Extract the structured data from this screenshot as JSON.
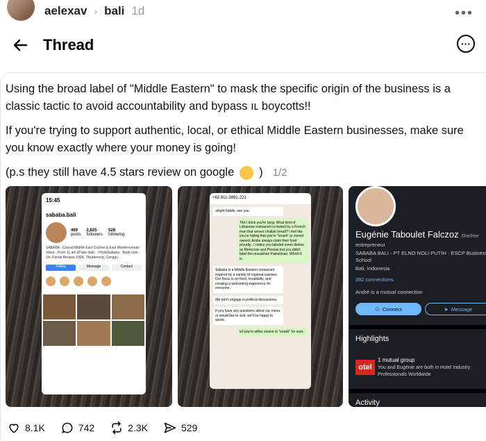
{
  "topbar": {
    "username": "aelexav",
    "location": "bali",
    "time": "1d"
  },
  "header": {
    "title": "Thread"
  },
  "post": {
    "paragraph1": "Using the broad label of \"Middle Eastern\" to mask the specific origin of the business is a classic tactic to avoid accountability and bypass ıʟ boycotts!!",
    "paragraph2": "If you're trying to support authentic, local, or ethical Middle Eastern businesses, make sure you know exactly where your money is going!",
    "paragraph3": "(p.s they still have 4.5 stars review on google",
    "paragraph3_end": ")",
    "pager": "1/2"
  },
  "media1": {
    "status_time": "15:45",
    "handle": "sababa.bali",
    "stats": [
      {
        "n": "469",
        "l": "posts"
      },
      {
        "n": "2,625",
        "l": "followers"
      },
      {
        "n": "528",
        "l": "following"
      }
    ],
    "bio": "SABABA · Casual Middle East Cuisine & East Mediterranean Vibes · From 11 am till late daily · #YallaSababa · Book now · Jln. Pantai Berawa 100A, Tibubeneng, Canggu",
    "follow_label": "Follow",
    "message_label": "Message",
    "contact_label": "Contact"
  },
  "media2": {
    "phone_number": "+62 811-3891-221",
    "messages": [
      {
        "side": "in",
        "text": "alright habibi, see you"
      },
      {
        "side": "out",
        "text": "Tbh I think you're lying. What kind of Lebanese restaurant is owned by a French man that serves challah bread? I feel like you're hiding that you're \"israeli\" or zionist owned. Arabs always claim their food proudly...I notice you labeled some dishes as Moroccan and Persian but you didn't label the musakhan Palestinian. Which it is."
      },
      {
        "side": "in",
        "text": "Sababa is a Middle Eastern restaurant inspired by a variety of regional cuisines. Our focus is on food, hospitality, and creating a welcoming experience for everyone."
      },
      {
        "side": "in",
        "text": "We don't engage in political discussions."
      },
      {
        "side": "in",
        "text": "If you have any questions about our menu or would like to visit, we'll be happy to assist."
      },
      {
        "side": "out",
        "text": "lol you're either zionist or \"israeli\" for sure."
      }
    ]
  },
  "media3": {
    "name": "Eugénie Taboulet Falczoz",
    "pronoun": "She/Her",
    "headline": "entrepreneur",
    "company": "SABABA BALI - PT ELNO NOLI PUTIH · ESCP Business School",
    "location": "Bali, Indonesia",
    "connections": "392 connections",
    "mutual": "André is a mutual connection",
    "connect_label": "Connect",
    "message_label": "Message",
    "highlights_title": "Highlights",
    "group_title": "1 mutual group",
    "group_text": "You and Eugénie are both in Hotel Industry Professionals Worldwide",
    "otel_logo": "otel",
    "activity_title": "Activity"
  },
  "actions": {
    "likes": "8.1K",
    "replies": "742",
    "reposts": "2.3K",
    "shares": "529"
  }
}
